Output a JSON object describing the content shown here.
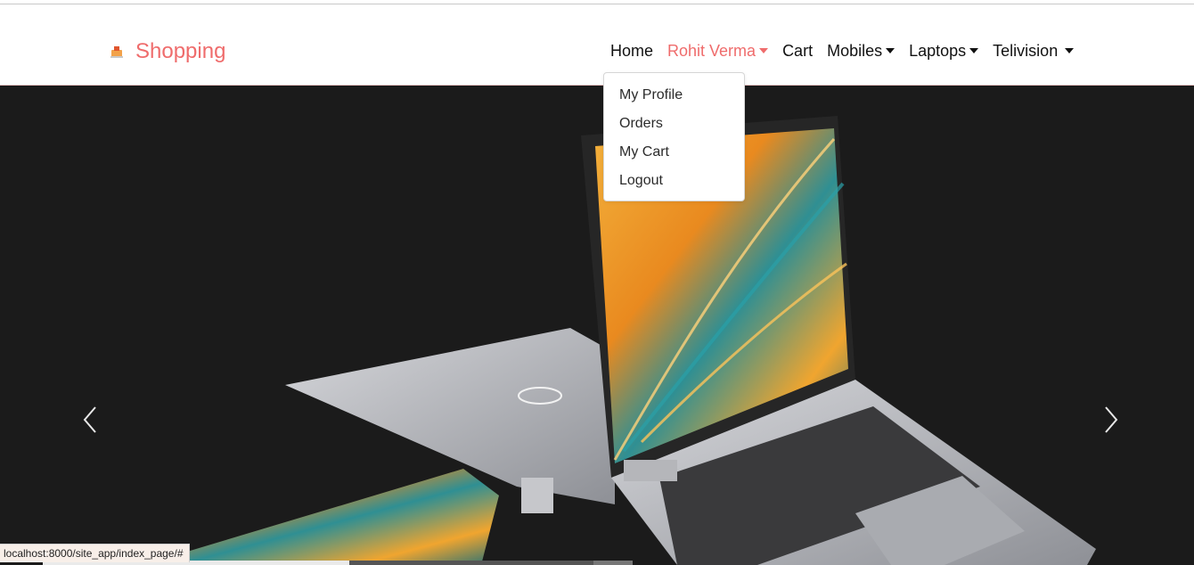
{
  "navbar": {
    "brand": "Shopping",
    "items": [
      {
        "label": "Home",
        "has_dropdown": false,
        "active": false
      },
      {
        "label": "Rohit Verma",
        "has_dropdown": true,
        "active": true
      },
      {
        "label": "Cart",
        "has_dropdown": false,
        "active": false
      },
      {
        "label": "Mobiles",
        "has_dropdown": true,
        "active": false
      },
      {
        "label": "Laptops",
        "has_dropdown": true,
        "active": false
      },
      {
        "label": "Telivision",
        "has_dropdown": true,
        "active": false
      }
    ]
  },
  "user_menu": {
    "items": [
      "My Profile",
      "Orders",
      "My Cart",
      "Logout"
    ]
  },
  "carousel": {
    "image": "laptop-banner"
  },
  "status_bar": {
    "url": "localhost:8000/site_app/index_page/#"
  },
  "colors": {
    "brand": "#ef6c6c",
    "carousel_bg": "#1b1b1b"
  }
}
